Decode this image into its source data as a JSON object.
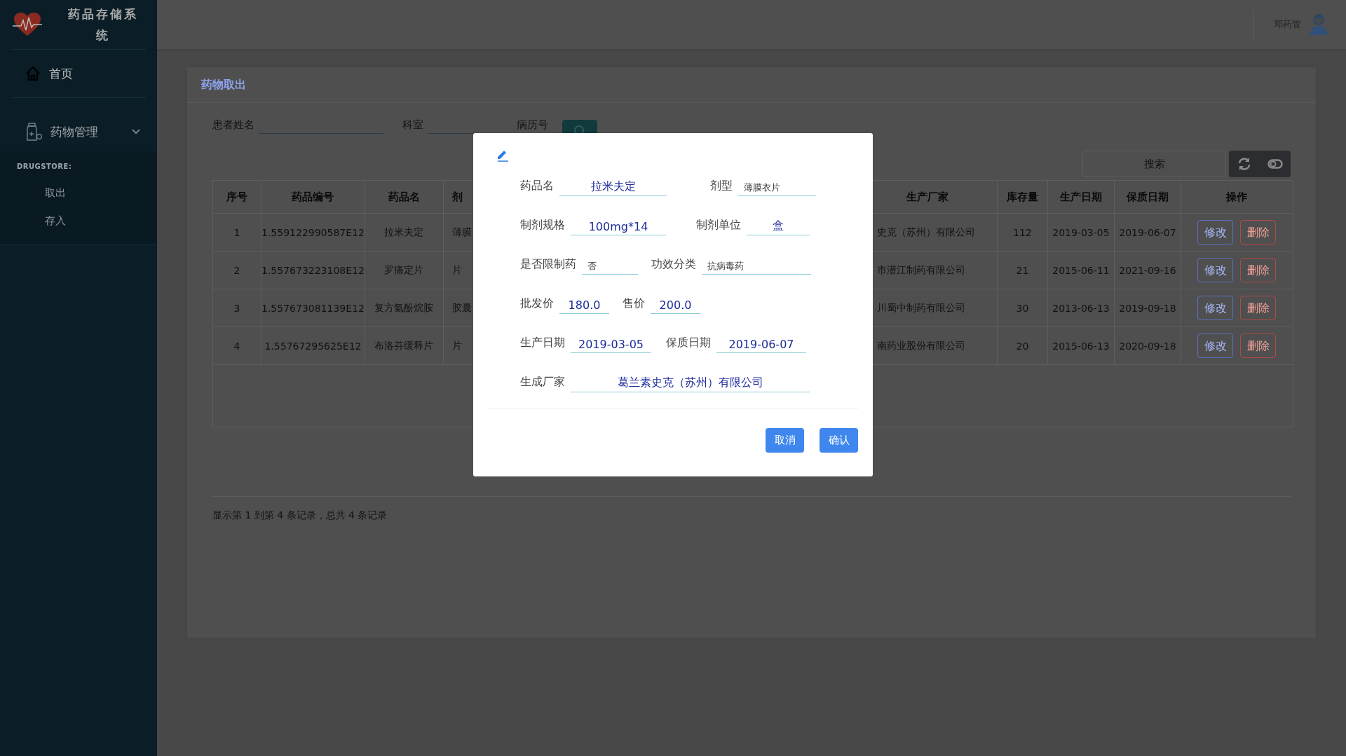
{
  "app": {
    "title": "药品存储系统"
  },
  "sidebar": {
    "items": [
      {
        "label": "首页",
        "kind": "link"
      },
      {
        "label": "药物管理",
        "kind": "group",
        "expanded": true,
        "section": "DRUGSTORE:",
        "children": [
          {
            "label": "取出"
          },
          {
            "label": "存入"
          }
        ]
      }
    ]
  },
  "header": {
    "user": "邓药管"
  },
  "panel": {
    "title": "药物取出",
    "filters": [
      {
        "label": "患者姓名"
      },
      {
        "label": "科室"
      },
      {
        "label": "病历号"
      }
    ],
    "search": {
      "placeholder": "搜索"
    },
    "table": {
      "columns": [
        "序号",
        "药品编号",
        "药品名",
        "剂",
        "生产厂家",
        "库存量",
        "生产日期",
        "保质日期",
        "操作"
      ],
      "rows": [
        {
          "cells": [
            "1",
            "1.559122990587E12",
            "拉米夫定",
            "薄膜",
            "史克（苏州）有限公司",
            "112",
            "2019-03-05",
            "2019-06-07"
          ],
          "actions": [
            "修改",
            "删除"
          ]
        },
        {
          "cells": [
            "2",
            "1.557673223108E12",
            "罗痛定片",
            "片",
            "市潜江制药有限公司",
            "21",
            "2015-06-11",
            "2021-09-16"
          ],
          "actions": [
            "修改",
            "删除"
          ]
        },
        {
          "cells": [
            "3",
            "1.557673081139E12",
            "复方氨酚烷胺",
            "胶囊",
            "川蜀中制药有限公司",
            "30",
            "2013-06-13",
            "2019-09-18"
          ],
          "actions": [
            "修改",
            "删除"
          ]
        },
        {
          "cells": [
            "4",
            "1.55767295625E12",
            "布洛芬缓释片",
            "片",
            "南药业股份有限公司",
            "20",
            "2015-06-13",
            "2020-09-18"
          ],
          "actions": [
            "修改",
            "删除"
          ]
        }
      ]
    },
    "footer": "显示第 1 到第 4 条记录，总共 4 条记录"
  },
  "dialog": {
    "rows": [
      {
        "fields": [
          {
            "label": "药品名",
            "value": "拉米夫定",
            "kind": "text"
          },
          {
            "label": "剂型",
            "value": "薄膜衣片",
            "kind": "select"
          }
        ]
      },
      {
        "fields": [
          {
            "label": "制剂规格",
            "value": "100mg*14",
            "kind": "text"
          },
          {
            "label": "制剂单位",
            "value": "盒",
            "kind": "text"
          }
        ]
      },
      {
        "fields": [
          {
            "label": "是否限制药",
            "value": "否",
            "kind": "select"
          },
          {
            "label": "功效分类",
            "value": "抗病毒药",
            "kind": "select"
          }
        ]
      },
      {
        "fields": [
          {
            "label": "批发价",
            "value": "180.0",
            "kind": "text"
          },
          {
            "label": "售价",
            "value": "200.0",
            "kind": "text"
          }
        ]
      },
      {
        "fields": [
          {
            "label": "生产日期",
            "value": "2019-03-05",
            "kind": "text"
          },
          {
            "label": "保质日期",
            "value": "2019-06-07",
            "kind": "text"
          }
        ]
      },
      {
        "fields": [
          {
            "label": "生成厂家",
            "value": "葛兰素史克（苏州）有限公司",
            "kind": "text"
          }
        ]
      }
    ],
    "buttons": [
      "取消",
      "确认"
    ]
  }
}
